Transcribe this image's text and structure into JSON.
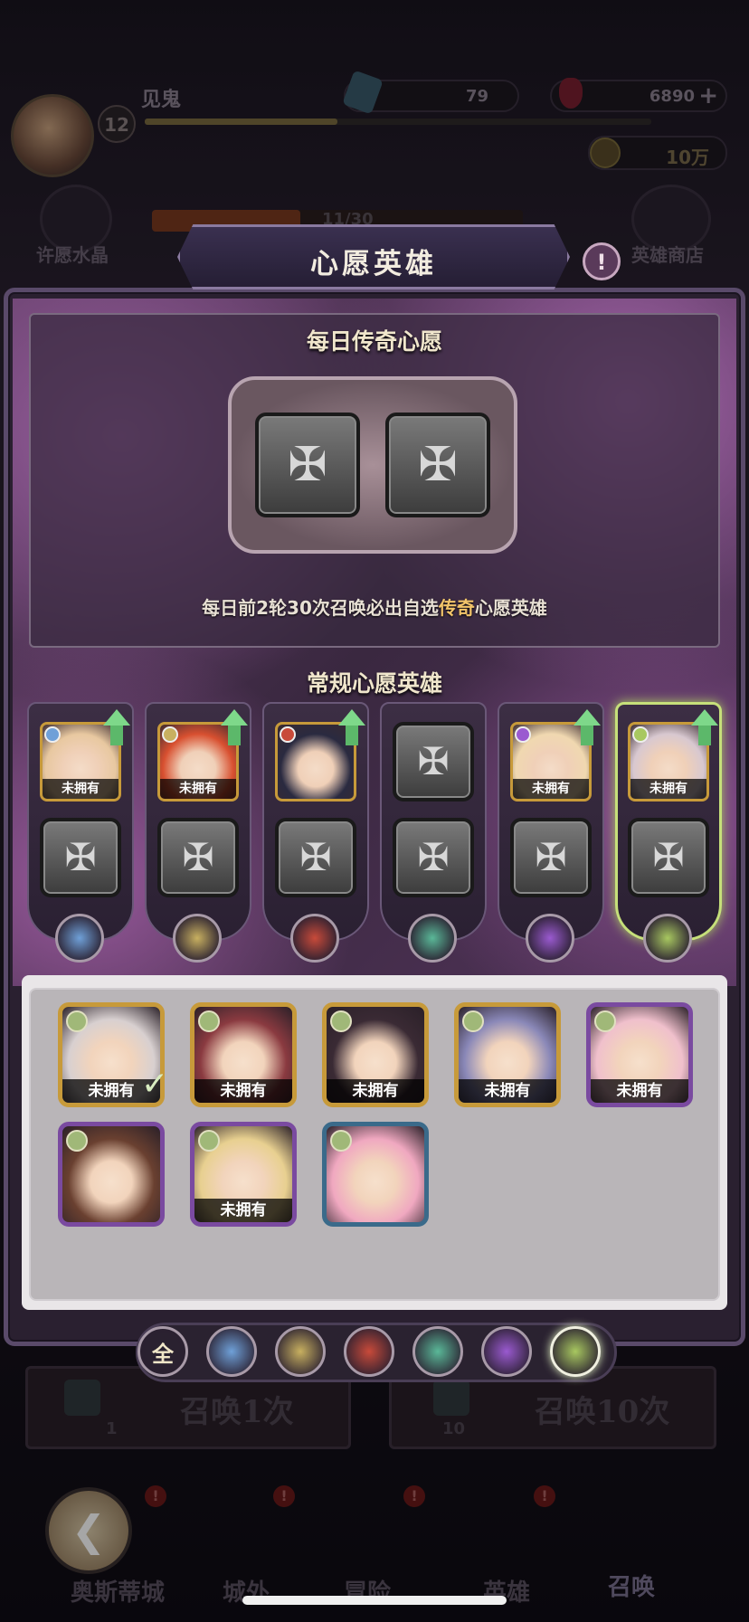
{
  "player": {
    "name": "见鬼",
    "level": "12"
  },
  "currencies": {
    "scroll_count": "79",
    "gem_count": "6890",
    "gold": "10万"
  },
  "hud": {
    "wish_crystal_label": "许愿水晶",
    "progress_text": "11/30",
    "hero_shop_label": "英雄商店"
  },
  "modal": {
    "title": "心愿英雄",
    "daily_section_title": "每日传奇心愿",
    "daily_desc_prefix": "每日前2轮30次召唤必出自选",
    "daily_desc_highlight": "传奇",
    "daily_desc_suffix": "心愿英雄",
    "regular_section_title": "常规心愿英雄"
  },
  "columns": [
    {
      "class_icon": "shield-icon",
      "class_color": "#6fa0d8",
      "hero_color": "#e8c8a0",
      "hero_tag": "未拥有",
      "has_hero": true,
      "upgrade": true,
      "selected": false
    },
    {
      "class_icon": "sword-icon",
      "class_color": "#c8b060",
      "hero_color": "#d85030",
      "hero_tag": "未拥有",
      "has_hero": true,
      "upgrade": true,
      "selected": false
    },
    {
      "class_icon": "dagger-icon",
      "class_color": "#c84a3a",
      "hero_color": "#2a2a40",
      "hero_tag": "",
      "has_hero": true,
      "upgrade": true,
      "selected": false
    },
    {
      "class_icon": "arrows-icon",
      "class_color": "#5ab898",
      "hero_color": "",
      "hero_tag": "",
      "has_hero": false,
      "upgrade": false,
      "selected": false
    },
    {
      "class_icon": "staff-icon",
      "class_color": "#9a5ad0",
      "hero_color": "#f0d8b0",
      "hero_tag": "未拥有",
      "has_hero": true,
      "upgrade": true,
      "selected": false
    },
    {
      "class_icon": "leaf-icon",
      "class_color": "#a8c860",
      "hero_color": "#d8c8d0",
      "hero_tag": "未拥有",
      "has_hero": true,
      "upgrade": true,
      "selected": true
    }
  ],
  "pool": [
    {
      "tag": "未拥有",
      "frame": "gold",
      "face": "#d8d0d0",
      "checked": true
    },
    {
      "tag": "未拥有",
      "frame": "gold",
      "face": "#8a3a40",
      "checked": false
    },
    {
      "tag": "未拥有",
      "frame": "gold",
      "face": "#3a2a34",
      "checked": false
    },
    {
      "tag": "未拥有",
      "frame": "gold",
      "face": "#8a88b8",
      "checked": false
    },
    {
      "tag": "未拥有",
      "frame": "purple",
      "face": "#f0c0cc",
      "checked": false
    },
    {
      "tag": "",
      "frame": "purple",
      "face": "#6a4030",
      "checked": false
    },
    {
      "tag": "未拥有",
      "frame": "purple",
      "face": "#e8d090",
      "checked": false
    },
    {
      "tag": "",
      "frame": "blue",
      "face": "#f0a8c0",
      "checked": false
    }
  ],
  "filters": [
    {
      "label": "全",
      "icon": "all-icon",
      "color": "#2a2230"
    },
    {
      "label": "",
      "icon": "shield-icon",
      "color": "#6fa0d8"
    },
    {
      "label": "",
      "icon": "sword-icon",
      "color": "#c8b060"
    },
    {
      "label": "",
      "icon": "dagger-icon",
      "color": "#c84a3a"
    },
    {
      "label": "",
      "icon": "arrows-icon",
      "color": "#5ab898"
    },
    {
      "label": "",
      "icon": "staff-icon",
      "color": "#9a5ad0"
    },
    {
      "label": "",
      "icon": "leaf-icon",
      "color": "#a8c860",
      "active": true
    }
  ],
  "summon": {
    "once_label": "召唤1次",
    "once_cost": "1",
    "ten_label": "召唤10次",
    "ten_cost": "10"
  },
  "nav": {
    "city": "奥斯蒂城",
    "outside": "城外",
    "adventure": "冒险",
    "heroes": "英雄",
    "summon": "召唤"
  },
  "glyphs": {
    "cross": "✠",
    "check": "✓",
    "back": "❮",
    "info": "!",
    "plus": "+",
    "alert": "!"
  }
}
